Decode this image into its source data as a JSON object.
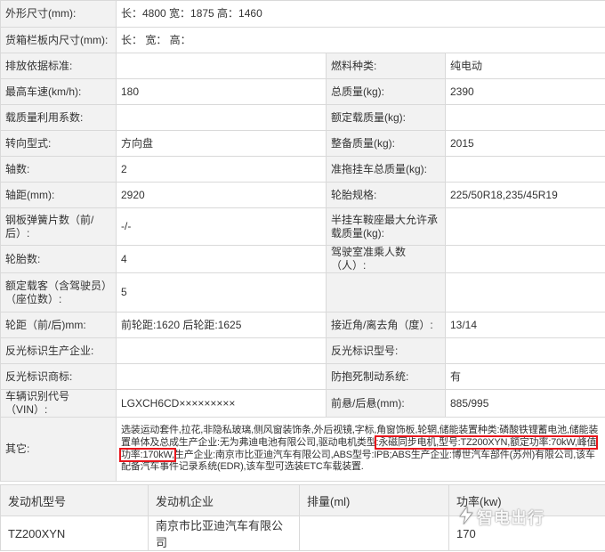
{
  "spec": [
    {
      "l1": "外形尺寸(mm):",
      "v1": "长：4800 宽：1875 高：1460"
    },
    {
      "l1": "货箱栏板内尺寸(mm):",
      "v1": "长： 宽： 高："
    },
    {
      "l1": "排放依据标准:",
      "v1": "",
      "l2": "燃料种类:",
      "v2": "纯电动"
    },
    {
      "l1": "最高车速(km/h):",
      "v1": "180",
      "l2": "总质量(kg):",
      "v2": "2390"
    },
    {
      "l1": "载质量利用系数:",
      "v1": "",
      "l2": "额定载质量(kg):",
      "v2": ""
    },
    {
      "l1": "转向型式:",
      "v1": "方向盘",
      "l2": "整备质量(kg):",
      "v2": "2015"
    },
    {
      "l1": "轴数:",
      "v1": "2",
      "l2": "准拖挂车总质量(kg):",
      "v2": ""
    },
    {
      "l1": "轴距(mm):",
      "v1": "2920",
      "l2": "轮胎规格:",
      "v2": "225/50R18,235/45R19"
    },
    {
      "l1": "钢板弹簧片数（前/后）:",
      "v1": "-/-",
      "l2": "半挂车鞍座最大允许承载质量(kg):",
      "v2": ""
    },
    {
      "l1": "轮胎数:",
      "v1": "4",
      "l2": "驾驶室准乘人数（人）:",
      "v2": ""
    },
    {
      "l1": "额定载客（含驾驶员）（座位数）:",
      "v1": "5",
      "l2": "",
      "v2": ""
    },
    {
      "l1": "轮距（前/后)mm:",
      "v1": "前轮距:1620 后轮距:1625",
      "l2": "接近角/离去角（度）:",
      "v2": "13/14"
    },
    {
      "l1": "反光标识生产企业:",
      "v1": "",
      "l2": "反光标识型号:",
      "v2": ""
    },
    {
      "l1": "反光标识商标:",
      "v1": "",
      "l2": "防抱死制动系统:",
      "v2": "有"
    },
    {
      "l1": "车辆识别代号（VIN）:",
      "v1": "LGXCH6CD×××××××××",
      "l2": "前悬/后悬(mm):",
      "v2": "885/995"
    }
  ],
  "other": {
    "label": "其它:",
    "text_before": "选装运动套件,拉花,非隐私玻璃,侧风窗装饰条,外后视镜,字标,角窗饰板,轮辋,储能装置种类:磷酸铁锂蓄电池,储能装置单体及总成生产企业:无为弗迪电池有限公司,驱动电机类型",
    "text_highlight": ":永磁同步电机,型号:TZ200XYN,额定功率:70kW,峰值功率:170kW,",
    "text_after": "生产企业:南京市比亚迪汽车有限公司,ABS型号:IPB;ABS生产企业:博世汽车部件(苏州)有限公司,该车配备汽车事件记录系统(EDR),该车型可选装ETC车载装置."
  },
  "engine": {
    "headers": [
      "发动机型号",
      "发动机企业",
      "排量(ml)",
      "功率(kw)"
    ],
    "row": [
      "TZ200XYN",
      "南京市比亚迪汽车有限公司",
      "",
      "170"
    ]
  },
  "watermark": {
    "text": "智电出行",
    "icon": "lightning-logo-icon"
  },
  "colors": {
    "highlight": "#e8141b",
    "label_bg": "#f2f2f2",
    "border": "#d9d9d9"
  }
}
